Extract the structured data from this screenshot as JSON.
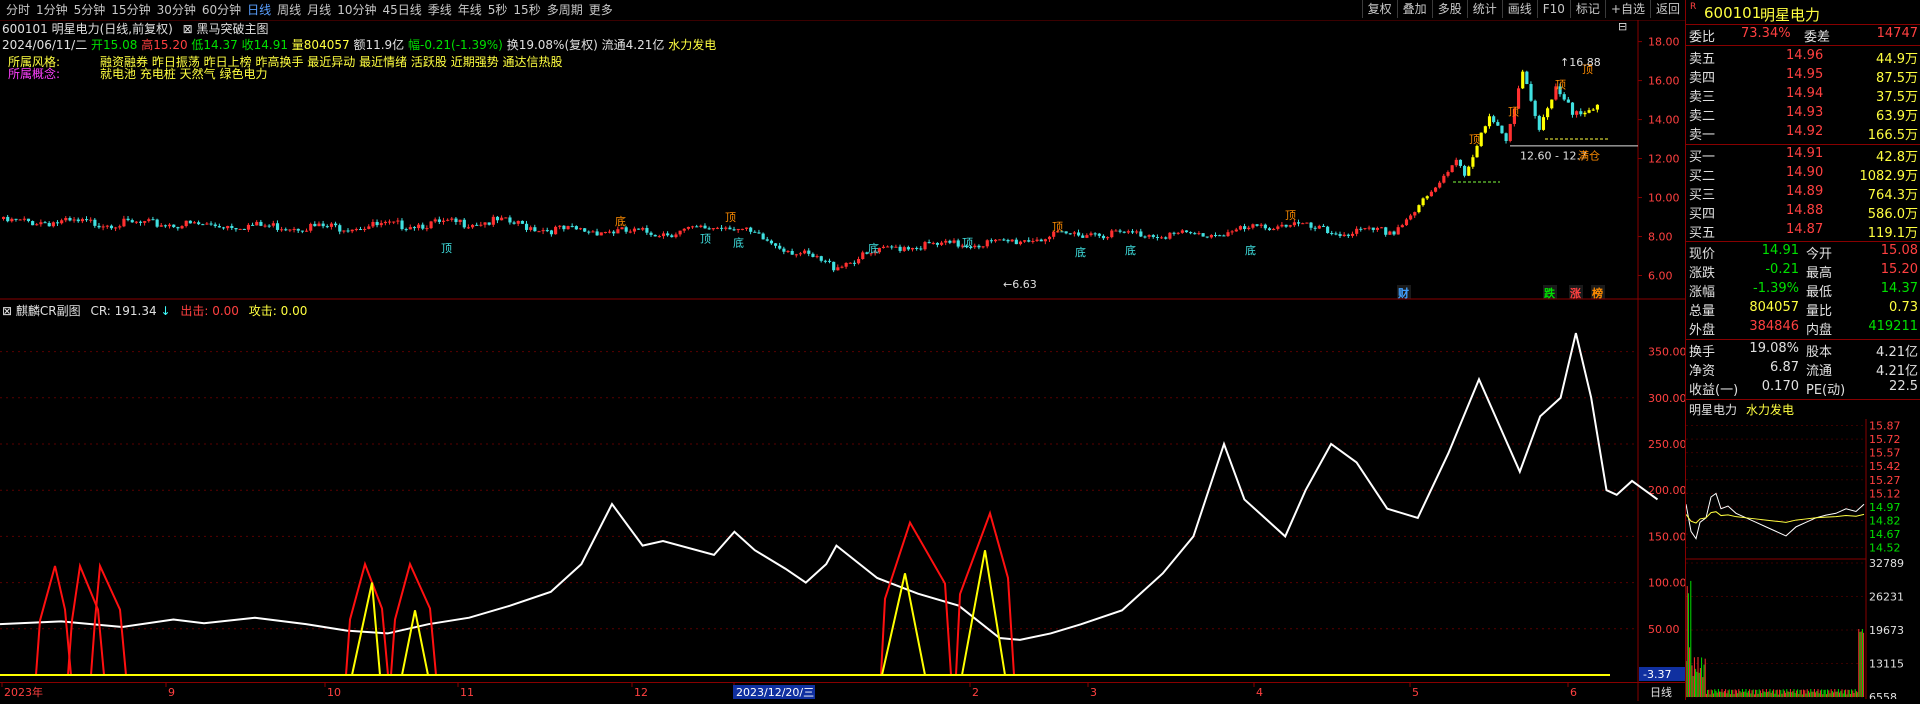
{
  "toolbar": {
    "periods": [
      "分时",
      "1分钟",
      "5分钟",
      "15分钟",
      "30分钟",
      "60分钟",
      "日线",
      "周线",
      "月线",
      "10分钟",
      "45日线",
      "季线",
      "年线",
      "5秒",
      "15秒",
      "多周期",
      "更多"
    ],
    "active_period": "日线",
    "tools": [
      "复权",
      "叠加",
      "多股",
      "统计",
      "画线",
      "F10",
      "标记",
      "+自选",
      "返回"
    ]
  },
  "main_chart": {
    "stock_header": "600101 明星电力(日线,前复权)",
    "indicator_name": "黑马突破主图",
    "date": "2024/06/11/二",
    "open": "开15.08",
    "high": "高15.20",
    "low": "低14.37",
    "close": "收14.91",
    "volume": "量804057",
    "amount": "额11.9亿",
    "change": "幅-0.21(-1.39%)",
    "turnover": "换19.08%(复权)",
    "float_cap": "流通4.21亿",
    "industry": "水力发电",
    "style_label": "所属风格:",
    "style_value": "融资融券 昨日振荡 昨日上榜 昨高换手 最近异动 最近情绪 活跃股 近期强势 通达信热股",
    "concept_label": "所属概念:",
    "concept_value": "就电池 充电桩 天然气 绿色电力",
    "price_ticks": [
      "18.00",
      "16.00",
      "14.00",
      "12.00",
      "10.00",
      "8.00",
      "6.00"
    ],
    "markers": [
      "顶",
      "底",
      "顶",
      "顶",
      "底",
      "底",
      "顶",
      "底",
      "顶",
      "底",
      "底",
      "顶",
      "顶",
      "顶",
      "顶",
      "顶"
    ],
    "high_label": "16.88",
    "low_label": "6.63",
    "range_label": "12.60 - 12.7",
    "position_label": "满仓",
    "event_tags": [
      "财",
      "跌",
      "涨",
      "榜"
    ]
  },
  "sub_chart": {
    "name": "麒麟CR副图",
    "cr_label": "CR: 191.34",
    "out_label": "出击: 0.00",
    "attack_label": "攻击: 0.00",
    "y_ticks": [
      "350.00",
      "300.00",
      "250.00",
      "200.00",
      "150.00",
      "100.00",
      "50.00"
    ],
    "cursor_value": "-3.37"
  },
  "time_axis": {
    "labels": [
      "2023年",
      "9",
      "10",
      "11",
      "12",
      "2023/12/20/三",
      "2",
      "3",
      "4",
      "5",
      "6"
    ],
    "period_name": "日线"
  },
  "quote": {
    "code": "600101",
    "name": "明星电力",
    "ratio_label": "委比",
    "ratio_value": "73.34%",
    "diff_label": "委差",
    "diff_value": "14747",
    "asks": [
      {
        "label": "卖五",
        "price": "14.96",
        "vol": "44.9万"
      },
      {
        "label": "卖四",
        "price": "14.95",
        "vol": "87.5万"
      },
      {
        "label": "卖三",
        "price": "14.94",
        "vol": "37.5万"
      },
      {
        "label": "卖二",
        "price": "14.93",
        "vol": "63.9万"
      },
      {
        "label": "卖一",
        "price": "14.92",
        "vol": "166.5万"
      }
    ],
    "bids": [
      {
        "label": "买一",
        "price": "14.91",
        "vol": "42.8万"
      },
      {
        "label": "买二",
        "price": "14.90",
        "vol": "1082.9万"
      },
      {
        "label": "买三",
        "price": "14.89",
        "vol": "764.3万"
      },
      {
        "label": "买四",
        "price": "14.88",
        "vol": "586.0万"
      },
      {
        "label": "买五",
        "price": "14.87",
        "vol": "119.1万"
      }
    ],
    "stats": [
      {
        "l1": "现价",
        "v1": "14.91",
        "l2": "今开",
        "v2": "15.08"
      },
      {
        "l1": "涨跌",
        "v1": "-0.21",
        "l2": "最高",
        "v2": "15.20"
      },
      {
        "l1": "涨幅",
        "v1": "-1.39%",
        "l2": "最低",
        "v2": "14.37"
      },
      {
        "l1": "总量",
        "v1": "804057",
        "l2": "量比",
        "v2": "0.73"
      },
      {
        "l1": "外盘",
        "v1": "384846",
        "l2": "内盘",
        "v2": "419211"
      }
    ],
    "fund": [
      {
        "l1": "换手",
        "v1": "19.08%",
        "l2": "股本",
        "v2": "4.21亿"
      },
      {
        "l1": "净资",
        "v1": "6.87",
        "l2": "流通",
        "v2": "4.21亿"
      },
      {
        "l1": "收益(一)",
        "v1": "0.170",
        "l2": "PE(动)",
        "v2": "22.5"
      }
    ]
  },
  "intraday": {
    "name": "明星电力",
    "industry": "水力发电",
    "price_ticks": [
      "15.87",
      "15.72",
      "15.57",
      "15.42",
      "15.27",
      "15.12",
      "14.97",
      "14.82",
      "14.67",
      "14.52"
    ],
    "vol_ticks": [
      "32789",
      "26231",
      "19673",
      "13115",
      "6558"
    ]
  }
}
